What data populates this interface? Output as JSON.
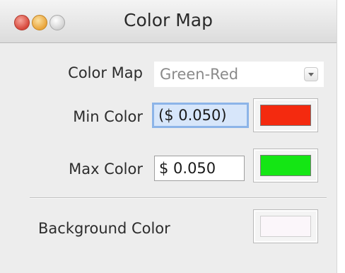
{
  "window": {
    "title": "Color Map"
  },
  "form": {
    "color_map": {
      "label": "Color Map",
      "selected": "Green-Red",
      "icon": "chevron-down-icon"
    },
    "min_color": {
      "label": "Min Color",
      "value": "($ 0.050)",
      "swatch_color": "#f42a0f"
    },
    "max_color": {
      "label": "Max Color",
      "value": "$ 0.050",
      "swatch_color": "#14e614"
    },
    "background_color": {
      "label": "Background Color",
      "swatch_color": "#fbf6fa"
    }
  },
  "colors": {
    "focus_ring": "#8cb4e8",
    "window_bg": "#ededed"
  }
}
